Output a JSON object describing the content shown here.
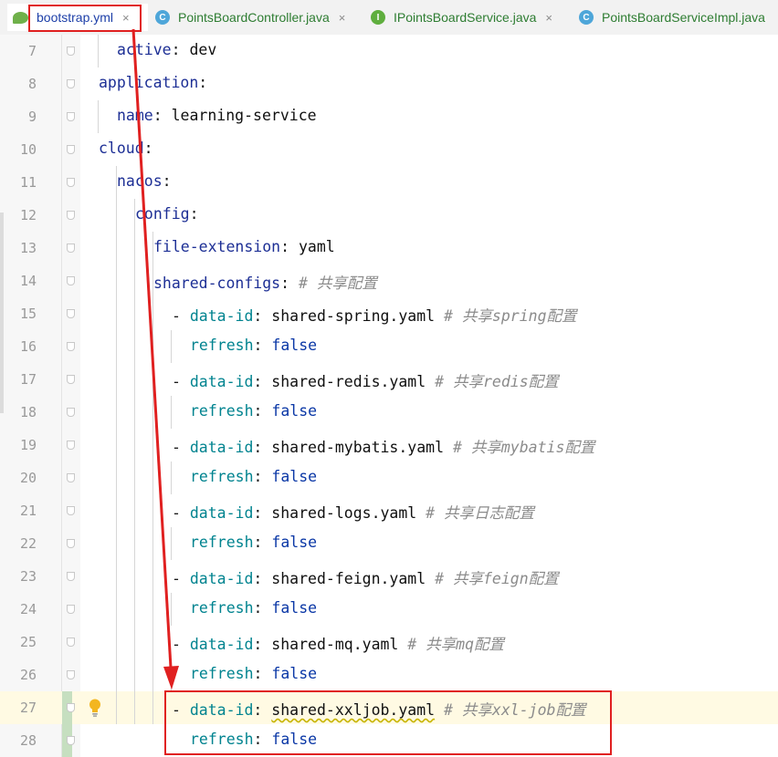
{
  "tabs": [
    {
      "label": "bootstrap.yml",
      "icon": "yaml-spring-icon",
      "active": true
    },
    {
      "label": "PointsBoardController.java",
      "icon": "java-class-icon",
      "icon_letter": "C",
      "active": false
    },
    {
      "label": "IPointsBoardService.java",
      "icon": "java-interface-icon",
      "icon_letter": "I",
      "active": false
    },
    {
      "label": "PointsBoardServiceImpl.java",
      "icon": "java-class-icon",
      "icon_letter": "C",
      "active": false
    }
  ],
  "tab_close_glyph": "×",
  "colors": {
    "yaml_key": "#1d2f95",
    "nested_key": "#00838f",
    "keyword": "#0a37a6",
    "comment": "#8b8b8b",
    "annotation_red": "#e02020",
    "highlight_line": "#fffae3",
    "vcs_changed": "#c6dfc0"
  },
  "highlighted_line": 27,
  "intention_icon": "lightbulb-icon",
  "lines": [
    {
      "n": "7",
      "parts": [
        {
          "t": "active",
          "c": "k"
        },
        {
          "t": ": ",
          "c": "p"
        },
        {
          "t": "dev",
          "c": "v"
        }
      ]
    },
    {
      "n": "8",
      "parts": [
        {
          "t": "application",
          "c": "k"
        },
        {
          "t": ":",
          "c": "p"
        }
      ]
    },
    {
      "n": "9",
      "parts": [
        {
          "t": "name",
          "c": "k"
        },
        {
          "t": ": ",
          "c": "p"
        },
        {
          "t": "learning-service",
          "c": "v"
        }
      ]
    },
    {
      "n": "10",
      "parts": [
        {
          "t": "cloud",
          "c": "k"
        },
        {
          "t": ":",
          "c": "p"
        }
      ]
    },
    {
      "n": "11",
      "parts": [
        {
          "t": "nacos",
          "c": "k"
        },
        {
          "t": ":",
          "c": "p"
        }
      ]
    },
    {
      "n": "12",
      "parts": [
        {
          "t": "config",
          "c": "k"
        },
        {
          "t": ":",
          "c": "p"
        }
      ]
    },
    {
      "n": "13",
      "parts": [
        {
          "t": "file-extension",
          "c": "k"
        },
        {
          "t": ": ",
          "c": "p"
        },
        {
          "t": "yaml",
          "c": "v"
        }
      ]
    },
    {
      "n": "14",
      "parts": [
        {
          "t": "shared-configs",
          "c": "k"
        },
        {
          "t": ": ",
          "c": "p"
        },
        {
          "t": "# 共享配置",
          "c": "c"
        }
      ]
    },
    {
      "n": "15",
      "parts": [
        {
          "t": "- ",
          "c": "p"
        },
        {
          "t": "data-id",
          "c": "g"
        },
        {
          "t": ": ",
          "c": "p"
        },
        {
          "t": "shared-spring.yaml",
          "c": "v"
        },
        {
          "t": " # 共享spring配置",
          "c": "c"
        }
      ]
    },
    {
      "n": "16",
      "parts": [
        {
          "t": "refresh",
          "c": "g"
        },
        {
          "t": ": ",
          "c": "p"
        },
        {
          "t": "false",
          "c": "kw"
        }
      ]
    },
    {
      "n": "17",
      "parts": [
        {
          "t": "- ",
          "c": "p"
        },
        {
          "t": "data-id",
          "c": "g"
        },
        {
          "t": ": ",
          "c": "p"
        },
        {
          "t": "shared-redis.yaml",
          "c": "v"
        },
        {
          "t": " # 共享redis配置",
          "c": "c"
        }
      ]
    },
    {
      "n": "18",
      "parts": [
        {
          "t": "refresh",
          "c": "g"
        },
        {
          "t": ": ",
          "c": "p"
        },
        {
          "t": "false",
          "c": "kw"
        }
      ]
    },
    {
      "n": "19",
      "parts": [
        {
          "t": "- ",
          "c": "p"
        },
        {
          "t": "data-id",
          "c": "g"
        },
        {
          "t": ": ",
          "c": "p"
        },
        {
          "t": "shared-mybatis.yaml",
          "c": "v"
        },
        {
          "t": " # 共享mybatis配置",
          "c": "c"
        }
      ]
    },
    {
      "n": "20",
      "parts": [
        {
          "t": "refresh",
          "c": "g"
        },
        {
          "t": ": ",
          "c": "p"
        },
        {
          "t": "false",
          "c": "kw"
        }
      ]
    },
    {
      "n": "21",
      "parts": [
        {
          "t": "- ",
          "c": "p"
        },
        {
          "t": "data-id",
          "c": "g"
        },
        {
          "t": ": ",
          "c": "p"
        },
        {
          "t": "shared-logs.yaml",
          "c": "v"
        },
        {
          "t": " # 共享日志配置",
          "c": "c"
        }
      ]
    },
    {
      "n": "22",
      "parts": [
        {
          "t": "refresh",
          "c": "g"
        },
        {
          "t": ": ",
          "c": "p"
        },
        {
          "t": "false",
          "c": "kw"
        }
      ]
    },
    {
      "n": "23",
      "parts": [
        {
          "t": "- ",
          "c": "p"
        },
        {
          "t": "data-id",
          "c": "g"
        },
        {
          "t": ": ",
          "c": "p"
        },
        {
          "t": "shared-feign.yaml",
          "c": "v"
        },
        {
          "t": " # 共享feign配置",
          "c": "c"
        }
      ]
    },
    {
      "n": "24",
      "parts": [
        {
          "t": "refresh",
          "c": "g"
        },
        {
          "t": ": ",
          "c": "p"
        },
        {
          "t": "false",
          "c": "kw"
        }
      ]
    },
    {
      "n": "25",
      "parts": [
        {
          "t": "- ",
          "c": "p"
        },
        {
          "t": "data-id",
          "c": "g"
        },
        {
          "t": ": ",
          "c": "p"
        },
        {
          "t": "shared-mq.yaml",
          "c": "v"
        },
        {
          "t": " # 共享mq配置",
          "c": "c"
        }
      ]
    },
    {
      "n": "26",
      "parts": [
        {
          "t": "refresh",
          "c": "g"
        },
        {
          "t": ": ",
          "c": "p"
        },
        {
          "t": "false",
          "c": "kw"
        }
      ]
    },
    {
      "n": "27",
      "parts": [
        {
          "t": "- ",
          "c": "p"
        },
        {
          "t": "data-id",
          "c": "g"
        },
        {
          "t": ": ",
          "c": "p"
        },
        {
          "t": "shared-xxljob.yaml",
          "c": "v",
          "squiggle": true
        },
        {
          "t": " # 共享xxl-job配置",
          "c": "c"
        }
      ]
    },
    {
      "n": "28",
      "parts": [
        {
          "t": "refresh",
          "c": "g"
        },
        {
          "t": ": ",
          "c": "p"
        },
        {
          "t": "false",
          "c": "kw"
        }
      ]
    }
  ]
}
